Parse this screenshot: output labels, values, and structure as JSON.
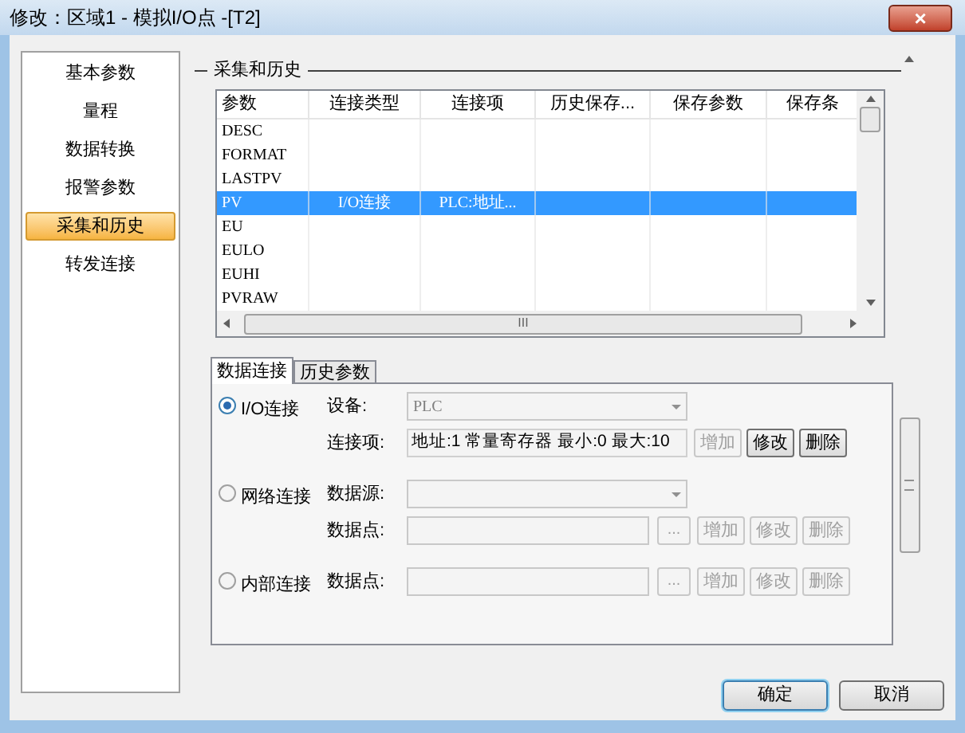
{
  "window": {
    "title": "修改：区域1 - 模拟I/O点 -[T2]",
    "close": "×"
  },
  "nav": [
    {
      "label": "基本参数",
      "selected": false
    },
    {
      "label": "量程",
      "selected": false
    },
    {
      "label": "数据转换",
      "selected": false
    },
    {
      "label": "报警参数",
      "selected": false
    },
    {
      "label": "采集和历史",
      "selected": true
    },
    {
      "label": "转发连接",
      "selected": false
    }
  ],
  "group_title": "采集和历史",
  "table": {
    "columns": [
      "参数",
      "连接类型",
      "连接项",
      "历史保存...",
      "保存参数",
      "保存条"
    ],
    "rows": [
      {
        "cells": [
          "DESC"
        ],
        "selected": false
      },
      {
        "cells": [
          "FORMAT"
        ],
        "selected": false
      },
      {
        "cells": [
          "LASTPV"
        ],
        "selected": false
      },
      {
        "cells": [
          "PV",
          "I/O连接",
          "PLC:地址..."
        ],
        "selected": true
      },
      {
        "cells": [
          "EU"
        ],
        "selected": false
      },
      {
        "cells": [
          "EULO"
        ],
        "selected": false
      },
      {
        "cells": [
          "EUHI"
        ],
        "selected": false
      },
      {
        "cells": [
          "PVRAW"
        ],
        "selected": false
      }
    ],
    "scroll_mark": "III"
  },
  "tabs": [
    {
      "label": "数据连接",
      "selected": true
    },
    {
      "label": "历史参数",
      "selected": false
    }
  ],
  "connections": [
    {
      "label": "I/O连接",
      "selected": true,
      "fields": [
        {
          "kind": "dropdown",
          "label": "设备:",
          "value": "PLC",
          "disabled": true
        },
        {
          "kind": "text",
          "label": "连接项:",
          "value": "地址:1 常量寄存器 最小:0 最大:10",
          "buttons": [
            {
              "label": "增加",
              "disabled": true
            },
            {
              "label": "修改",
              "disabled": false
            },
            {
              "label": "删除",
              "disabled": false
            }
          ]
        }
      ]
    },
    {
      "label": "网络连接",
      "selected": false,
      "fields": [
        {
          "kind": "dropdown",
          "label": "数据源:",
          "disabled": true
        },
        {
          "kind": "browse",
          "label": "数据点:",
          "browse": "...",
          "buttons": [
            {
              "label": "增加",
              "disabled": true
            },
            {
              "label": "修改",
              "disabled": true
            },
            {
              "label": "删除",
              "disabled": true
            }
          ]
        }
      ]
    },
    {
      "label": "内部连接",
      "selected": false,
      "fields": [
        {
          "kind": "browse",
          "label": "数据点:",
          "browse": "...",
          "buttons": [
            {
              "label": "增加",
              "disabled": true
            },
            {
              "label": "修改",
              "disabled": true
            },
            {
              "label": "删除",
              "disabled": true
            }
          ]
        }
      ]
    }
  ],
  "buttons": [
    {
      "label": "确定",
      "default": true
    },
    {
      "label": "取消",
      "default": false
    }
  ]
}
